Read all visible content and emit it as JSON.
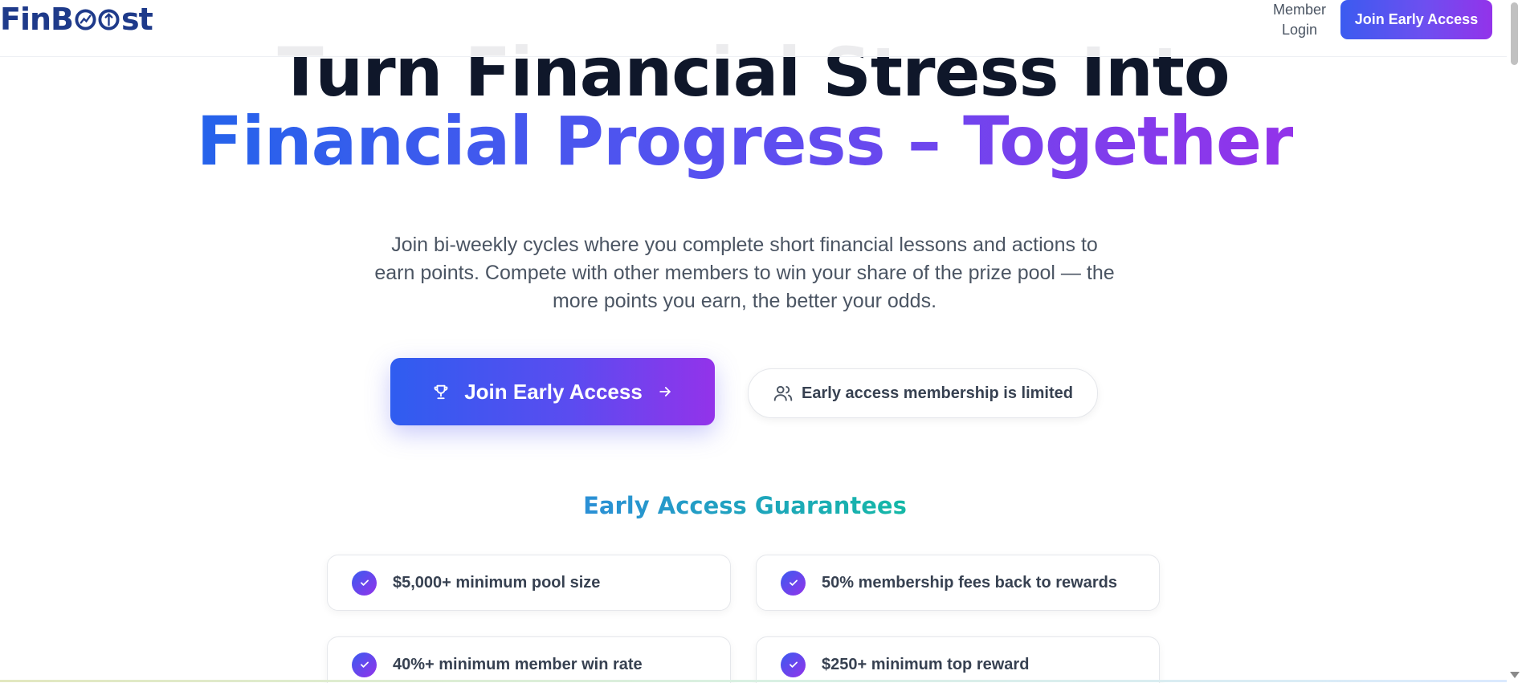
{
  "header": {
    "logo_text_left": "FinB",
    "logo_text_right": "st",
    "member_login_label": "Member\nLogin",
    "member_login_line1": "Member",
    "member_login_line2": "Login",
    "cta_label": "Join Early Access"
  },
  "hero": {
    "headline_line1": "Turn Financial Stress Into",
    "headline_line2": "Financial Progress – Together",
    "subtitle": "Join bi-weekly cycles where you complete short financial lessons and actions to earn points. Compete with other members to win your share of the prize pool — the more points you earn, the better your odds.",
    "primary_cta_label": "Join Early Access",
    "limited_notice": "Early access membership is limited"
  },
  "guarantees": {
    "title": "Early Access Guarantees",
    "items": [
      {
        "text": "$5,000+ minimum pool size"
      },
      {
        "text": "50% membership fees back to rewards"
      },
      {
        "text": "40%+ minimum member win rate"
      },
      {
        "text": "$250+ minimum top reward"
      }
    ]
  },
  "icons": {
    "trophy": "trophy-icon",
    "arrow": "arrow-right-icon",
    "users": "users-icon",
    "check": "check-icon"
  },
  "colors": {
    "brand_navy": "#1e3a8a",
    "gradient_start": "#2563eb",
    "gradient_end": "#9333ea",
    "guarantee_title_start": "#2b8fd6",
    "guarantee_title_end": "#14b8a6"
  }
}
